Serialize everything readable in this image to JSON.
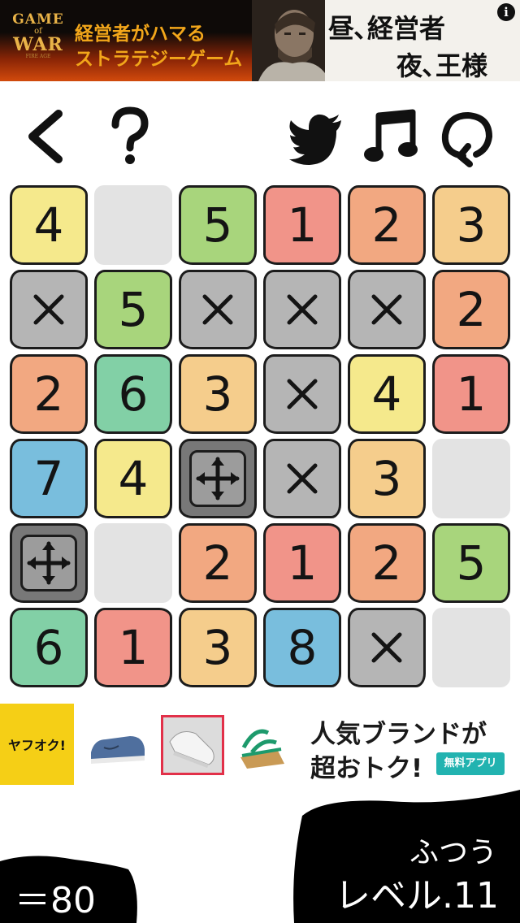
{
  "ad_top": {
    "logo_game": "GAME",
    "logo_of": "of",
    "logo_war": "WAR",
    "logo_sub": "FIRE AGE",
    "tagline_1": "経営者がハマる",
    "tagline_2": "ストラテジーゲーム",
    "copy_1": "昼､経営者",
    "copy_2": "夜､王様",
    "info_icon": "i",
    "colors": {
      "tagline": "#f2a61a",
      "flame": "#d24a0c"
    }
  },
  "toolbar": {
    "back_icon": "chevron-left-icon",
    "help_icon": "question-mark-icon",
    "twitter_icon": "twitter-bird-icon",
    "music_icon": "music-note-icon",
    "restart_icon": "refresh-icon"
  },
  "palette": {
    "yellow": "#f5e98c",
    "gray": "#b5b5b5",
    "green": "#a8d57c",
    "red": "#f19489",
    "salmon": "#f2a881",
    "orange": "#f5cd8c",
    "teal": "#82d0a6",
    "blue": "#79bedd",
    "empty": "#e3e3e3",
    "move": "#787878"
  },
  "board": {
    "rows": [
      [
        {
          "kind": "num",
          "value": "4",
          "color": "yellow"
        },
        {
          "kind": "empty"
        },
        {
          "kind": "num",
          "value": "5",
          "color": "green"
        },
        {
          "kind": "num",
          "value": "1",
          "color": "red"
        },
        {
          "kind": "num",
          "value": "2",
          "color": "salmon"
        },
        {
          "kind": "num",
          "value": "3",
          "color": "orange"
        }
      ],
      [
        {
          "kind": "x",
          "color": "gray"
        },
        {
          "kind": "num",
          "value": "5",
          "color": "green"
        },
        {
          "kind": "x",
          "color": "gray"
        },
        {
          "kind": "x",
          "color": "gray"
        },
        {
          "kind": "x",
          "color": "gray"
        },
        {
          "kind": "num",
          "value": "2",
          "color": "salmon"
        }
      ],
      [
        {
          "kind": "num",
          "value": "2",
          "color": "salmon"
        },
        {
          "kind": "num",
          "value": "6",
          "color": "teal"
        },
        {
          "kind": "num",
          "value": "3",
          "color": "orange"
        },
        {
          "kind": "x",
          "color": "gray"
        },
        {
          "kind": "num",
          "value": "4",
          "color": "yellow"
        },
        {
          "kind": "num",
          "value": "1",
          "color": "red"
        }
      ],
      [
        {
          "kind": "num",
          "value": "7",
          "color": "blue"
        },
        {
          "kind": "num",
          "value": "4",
          "color": "yellow"
        },
        {
          "kind": "move"
        },
        {
          "kind": "x",
          "color": "gray"
        },
        {
          "kind": "num",
          "value": "3",
          "color": "orange"
        },
        {
          "kind": "empty"
        }
      ],
      [
        {
          "kind": "move"
        },
        {
          "kind": "empty"
        },
        {
          "kind": "num",
          "value": "2",
          "color": "salmon"
        },
        {
          "kind": "num",
          "value": "1",
          "color": "red"
        },
        {
          "kind": "num",
          "value": "2",
          "color": "salmon"
        },
        {
          "kind": "num",
          "value": "5",
          "color": "green"
        }
      ],
      [
        {
          "kind": "num",
          "value": "6",
          "color": "teal"
        },
        {
          "kind": "num",
          "value": "1",
          "color": "red"
        },
        {
          "kind": "num",
          "value": "3",
          "color": "orange"
        },
        {
          "kind": "num",
          "value": "8",
          "color": "blue"
        },
        {
          "kind": "x",
          "color": "gray"
        },
        {
          "kind": "empty"
        }
      ]
    ]
  },
  "ad_bottom": {
    "brand": "ヤフオク!",
    "line_1": "人気ブランドが",
    "line_2": "超おトク!",
    "badge": "無料アプリ"
  },
  "status": {
    "score": "＝80",
    "difficulty": "ふつう",
    "level": "レベル.11"
  }
}
